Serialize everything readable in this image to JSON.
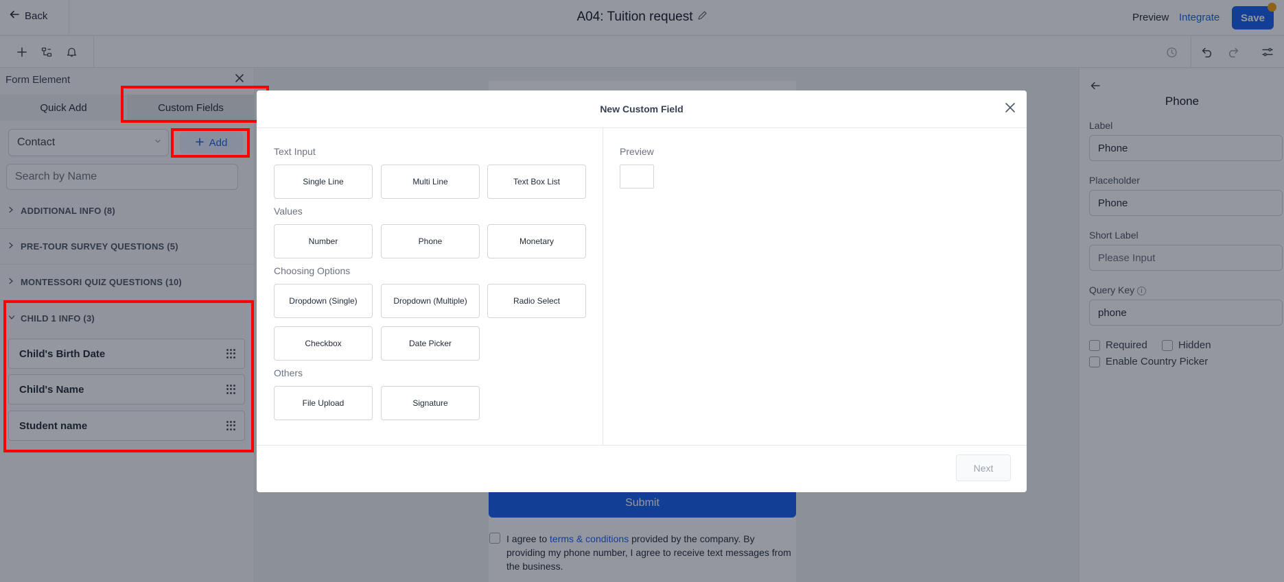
{
  "topbar": {
    "back_label": "Back",
    "title": "A04: Tuition request",
    "preview_label": "Preview",
    "integrate_label": "Integrate",
    "save_label": "Save"
  },
  "toolbar": {
    "icons": [
      "plus-icon",
      "layers-icon",
      "bell-icon",
      "history-icon",
      "undo-icon",
      "redo-icon",
      "settings-sliders-icon"
    ]
  },
  "left_panel": {
    "header": "Form Element",
    "tabs": [
      {
        "label": "Quick Add",
        "active": false
      },
      {
        "label": "Custom Fields",
        "active": true
      }
    ],
    "object_select": "Contact",
    "add_label": "Add",
    "search_placeholder": "Search by Name",
    "groups": [
      {
        "label": "ADDITIONAL INFO (8)",
        "expanded": false
      },
      {
        "label": "PRE-TOUR SURVEY QUESTIONS (5)",
        "expanded": false
      },
      {
        "label": "MONTESSORI QUIZ QUESTIONS (10)",
        "expanded": false
      },
      {
        "label": "CHILD 1 INFO (3)",
        "expanded": true
      }
    ],
    "fields": [
      "Child's Birth Date",
      "Child's Name",
      "Student name"
    ]
  },
  "form": {
    "submit_label": "Submit",
    "consent_pre": "I agree to ",
    "consent_link": "terms & conditions",
    "consent_post": " provided by the company. By providing my phone number, I agree to receive text messages from the business."
  },
  "right_panel": {
    "title": "Phone",
    "label_label": "Label",
    "label_value": "Phone",
    "placeholder_label": "Placeholder",
    "placeholder_value": "Phone",
    "short_label_label": "Short Label",
    "short_label_placeholder": "Please Input",
    "query_key_label": "Query Key",
    "query_key_value": "phone",
    "required_label": "Required",
    "hidden_label": "Hidden",
    "country_picker_label": "Enable Country Picker"
  },
  "modal": {
    "title": "New Custom Field",
    "sections": {
      "text_input": "Text Input",
      "values": "Values",
      "choosing_options": "Choosing Options",
      "others": "Others"
    },
    "buttons": {
      "single_line": "Single Line",
      "multi_line": "Multi Line",
      "text_box_list": "Text Box List",
      "number": "Number",
      "phone": "Phone",
      "monetary": "Monetary",
      "dropdown_single": "Dropdown (Single)",
      "dropdown_multiple": "Dropdown (Multiple)",
      "radio_select": "Radio Select",
      "checkbox": "Checkbox",
      "date_picker": "Date Picker",
      "file_upload": "File Upload",
      "signature": "Signature"
    },
    "preview_label": "Preview",
    "next_label": "Next"
  },
  "colors": {
    "accent": "#155eef",
    "highlight": "#ff0000",
    "notification_dot": "#f59e0b"
  }
}
